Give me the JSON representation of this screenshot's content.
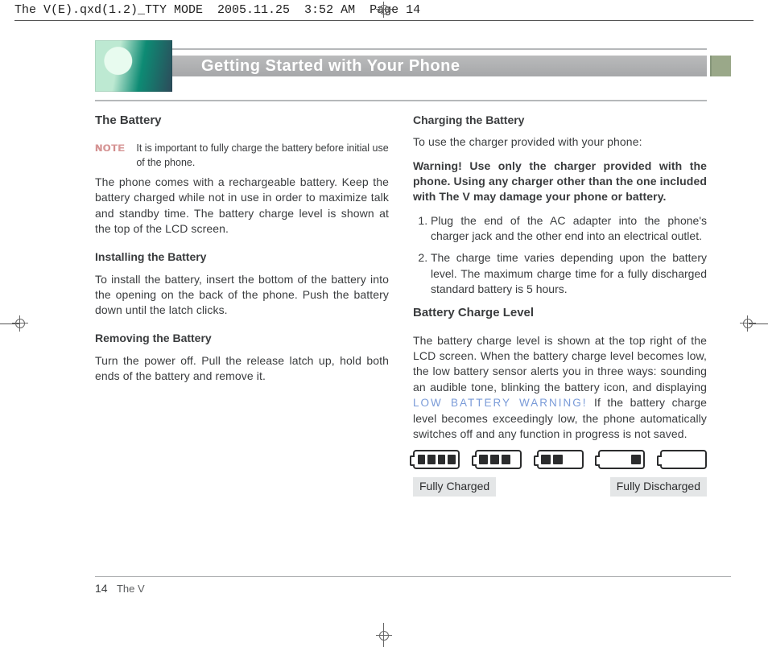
{
  "slug": "The V(E).qxd(1.2)_TTY MODE  2005.11.25  3:52 AM  Page 14",
  "header": {
    "title": "Getting Started with Your Phone"
  },
  "left": {
    "section": "The Battery",
    "note_label": "NOTE",
    "note_text": "It is important to fully charge the battery before initial use of the phone.",
    "p1": "The phone comes with a rechargeable battery. Keep the battery charged while not in use in order to maximize talk and standby time. The battery charge level is shown at the top of the LCD screen.",
    "install_h": "Installing the Battery",
    "install_p": "To install the battery, insert the bottom of the battery into the opening on the back of the phone. Push the battery down until the latch clicks.",
    "remove_h": "Removing the Battery",
    "remove_p": "Turn the power off. Pull the release latch up, hold both ends of the battery and remove it."
  },
  "right": {
    "charge_h": "Charging the Battery",
    "charge_intro": "To use the charger provided with your phone:",
    "charge_warn": "Warning! Use only the charger provided with the phone. Using any charger other than the one included with The V may damage your phone or battery.",
    "step1": "Plug the end of the AC adapter into the phone's charger jack and the other end into an electrical outlet.",
    "step2": "The charge time varies depending upon the battery level. The maximum charge time for a fully discharged standard battery is 5 hours.",
    "level_h": "Battery Charge Level",
    "level_p_a": "The battery charge level is shown at the top right of the LCD screen. When the battery charge level becomes low, the low battery sensor alerts you in three ways: sounding an audible tone, blinking the battery icon, and displaying ",
    "lbw": "LOW BATTERY WARNING!",
    "level_p_b": " If the battery charge level becomes exceedingly low, the phone automatically switches off and any function in progress is not saved.",
    "cap_full": "Fully Charged",
    "cap_empty": "Fully Discharged"
  },
  "footer": {
    "page_num": "14",
    "book": "The V"
  }
}
